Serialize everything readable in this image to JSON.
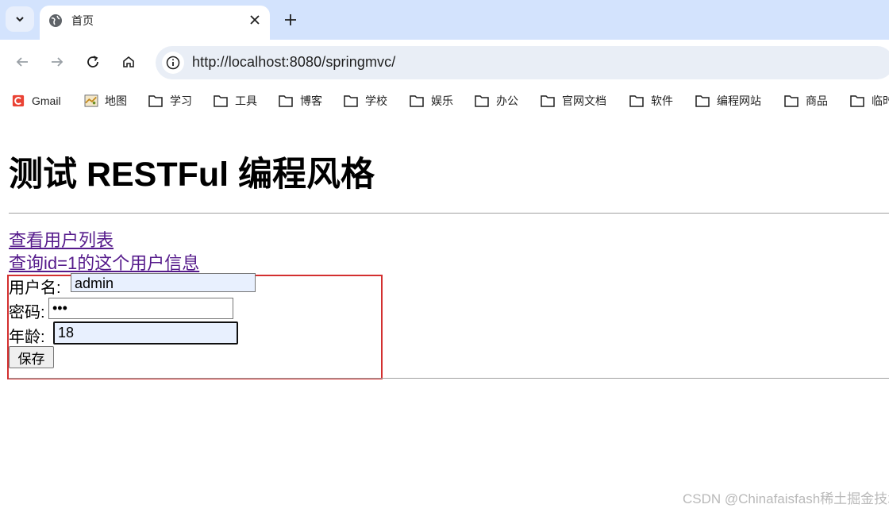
{
  "browser": {
    "tab": {
      "title": "首页"
    },
    "url": "http://localhost:8080/springmvc/",
    "bookmarks": [
      {
        "label": "Gmail",
        "icon": "gmail-icon"
      },
      {
        "label": "地图",
        "icon": "map-icon"
      },
      {
        "label": "学习",
        "icon": "folder-icon"
      },
      {
        "label": "工具",
        "icon": "folder-icon"
      },
      {
        "label": "博客",
        "icon": "folder-icon"
      },
      {
        "label": "学校",
        "icon": "folder-icon"
      },
      {
        "label": "娱乐",
        "icon": "folder-icon"
      },
      {
        "label": "办公",
        "icon": "folder-icon"
      },
      {
        "label": "官网文档",
        "icon": "folder-icon"
      },
      {
        "label": "软件",
        "icon": "folder-icon"
      },
      {
        "label": "编程网站",
        "icon": "folder-icon"
      },
      {
        "label": "商品",
        "icon": "folder-icon"
      },
      {
        "label": "临时",
        "icon": "folder-icon"
      }
    ]
  },
  "page": {
    "title": "测试 RESTFul 编程风格",
    "links": [
      {
        "label": "查看用户列表"
      },
      {
        "label": "查询id=1的这个用户信息"
      }
    ],
    "form": {
      "username_label": "用户名:",
      "username_value": "admin",
      "password_label": "密码:",
      "password_value": "•••",
      "age_label": "年龄:",
      "age_value": "18",
      "save_label": "保存"
    }
  },
  "watermark": "CSDN @Chinafaisfash稀土掘金技术社区",
  "colors": {
    "tabstrip": "#d3e3fd",
    "link_visited": "#551a8b",
    "highlight_box": "#d32f2f",
    "gmail": "#ea4335"
  }
}
